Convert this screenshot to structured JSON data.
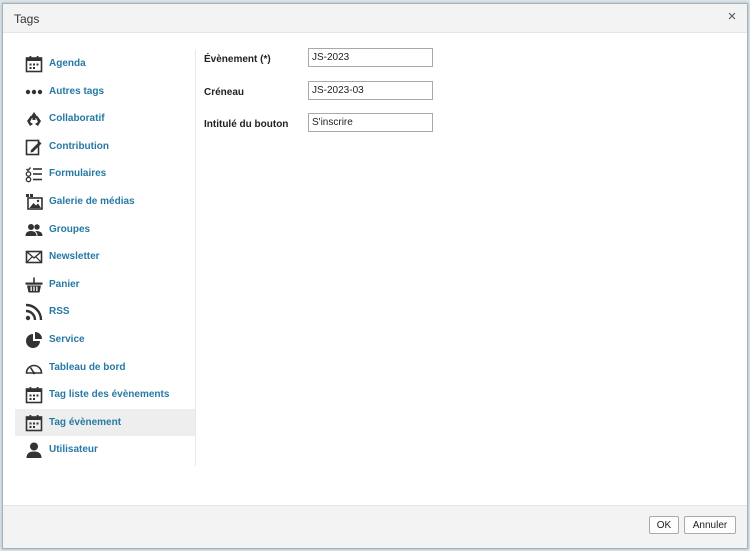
{
  "dialog": {
    "title": "Tags",
    "close_glyph": "×"
  },
  "sidebar": {
    "items": [
      {
        "label": "Agenda",
        "icon": "calendar-icon"
      },
      {
        "label": "Autres tags",
        "icon": "dots-icon"
      },
      {
        "label": "Collaboratif",
        "icon": "recycle-icon"
      },
      {
        "label": "Contribution",
        "icon": "edit-icon"
      },
      {
        "label": "Formulaires",
        "icon": "form-list-icon"
      },
      {
        "label": "Galerie de médias",
        "icon": "media-gallery-icon"
      },
      {
        "label": "Groupes",
        "icon": "group-icon"
      },
      {
        "label": "Newsletter",
        "icon": "envelope-icon"
      },
      {
        "label": "Panier",
        "icon": "basket-icon"
      },
      {
        "label": "RSS",
        "icon": "rss-icon"
      },
      {
        "label": "Service",
        "icon": "pie-chart-icon"
      },
      {
        "label": "Tableau de bord",
        "icon": "gauge-icon"
      },
      {
        "label": "Tag liste des évènements",
        "icon": "calendar-icon"
      },
      {
        "label": "Tag évènement",
        "icon": "calendar-icon",
        "active": true
      },
      {
        "label": "Utilisateur",
        "icon": "user-icon"
      }
    ]
  },
  "form": {
    "fields": [
      {
        "label": "Évènement (*)",
        "value": "JS-2023"
      },
      {
        "label": "Créneau",
        "value": "JS-2023-03"
      },
      {
        "label": "Intitulé du bouton",
        "value": "S'inscrire"
      }
    ]
  },
  "footer": {
    "ok_label": "OK",
    "cancel_label": "Annuler"
  },
  "colors": {
    "link": "#2679a5",
    "active_bg": "#eeeeee",
    "icon": "#333333"
  }
}
